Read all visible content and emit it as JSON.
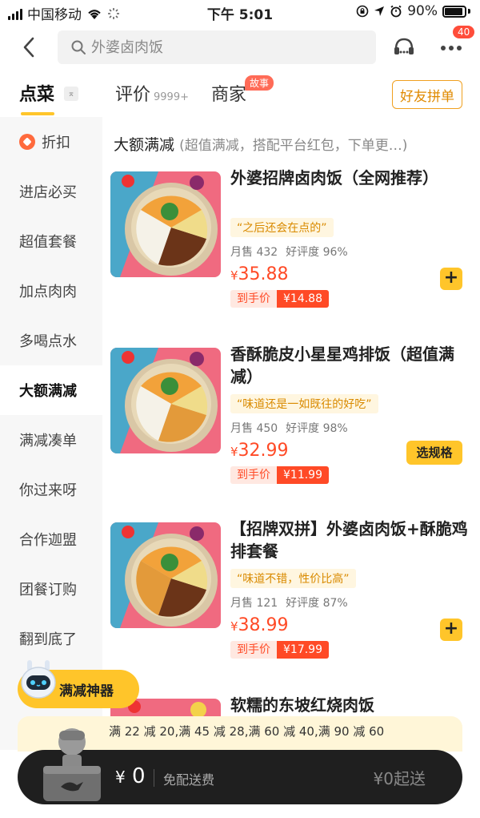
{
  "status_bar": {
    "carrier": "中国移动",
    "time": "下午 5:01",
    "battery": "90%"
  },
  "header": {
    "search_placeholder": "外婆卤肉饭",
    "message_count": "40"
  },
  "tabs": {
    "dishes": "点菜",
    "reviews": "评价",
    "reviews_count": "9999+",
    "merchant": "商家",
    "story_badge": "故事",
    "friend_order": "好友拼单"
  },
  "sidebar": {
    "items": [
      {
        "label": "折扣"
      },
      {
        "label": "进店必买"
      },
      {
        "label": "超值套餐"
      },
      {
        "label": "加点肉肉"
      },
      {
        "label": "多喝点水"
      },
      {
        "label": "大额满减"
      },
      {
        "label": "满减凑单"
      },
      {
        "label": "你过来呀"
      },
      {
        "label": "合作迦盟"
      },
      {
        "label": "团餐订购"
      },
      {
        "label": "翻到底了"
      }
    ]
  },
  "section": {
    "title": "大额满减",
    "description": "(超值满减，搭配平台红包，下单更…)"
  },
  "products": [
    {
      "name": "外婆招牌卤肉饭（全网推荐）",
      "quote": "“之后还会在点的”",
      "sales": "月售 432",
      "rating": "好评度 96%",
      "price_symbol": "¥",
      "price": "35.88",
      "final_label": "到手价",
      "final_price": "¥14.88",
      "action": "+"
    },
    {
      "name": "香酥脆皮小星星鸡排饭（超值满减）",
      "quote": "“味道还是一如既往的好吃”",
      "sales": "月售 450",
      "rating": "好评度 98%",
      "price_symbol": "¥",
      "price": "32.99",
      "final_label": "到手价",
      "final_price": "¥11.99",
      "action": "选规格"
    },
    {
      "name": "【招牌双拼】外婆卤肉饭+酥脆鸡排套餐",
      "quote": "“味道不错，性价比高”",
      "sales": "月售 121",
      "rating": "好评度 87%",
      "price_symbol": "¥",
      "price": "38.99",
      "final_label": "到手价",
      "final_price": "¥17.99",
      "action": "+"
    },
    {
      "name": "软糯的东坡红烧肉饭"
    }
  ],
  "helper": {
    "label": "满减神器"
  },
  "promo": {
    "text": "满 22 减 20,满 45 减 28,满 60 减 40,满 90 减 60"
  },
  "cart": {
    "symbol": "¥",
    "total": "0",
    "delivery": "免配送费",
    "min_order": "¥0起送"
  },
  "colors": {
    "accent_yellow": "#ffc52a",
    "price_red": "#ff4a26",
    "cart_bg": "#1f1f1f"
  }
}
